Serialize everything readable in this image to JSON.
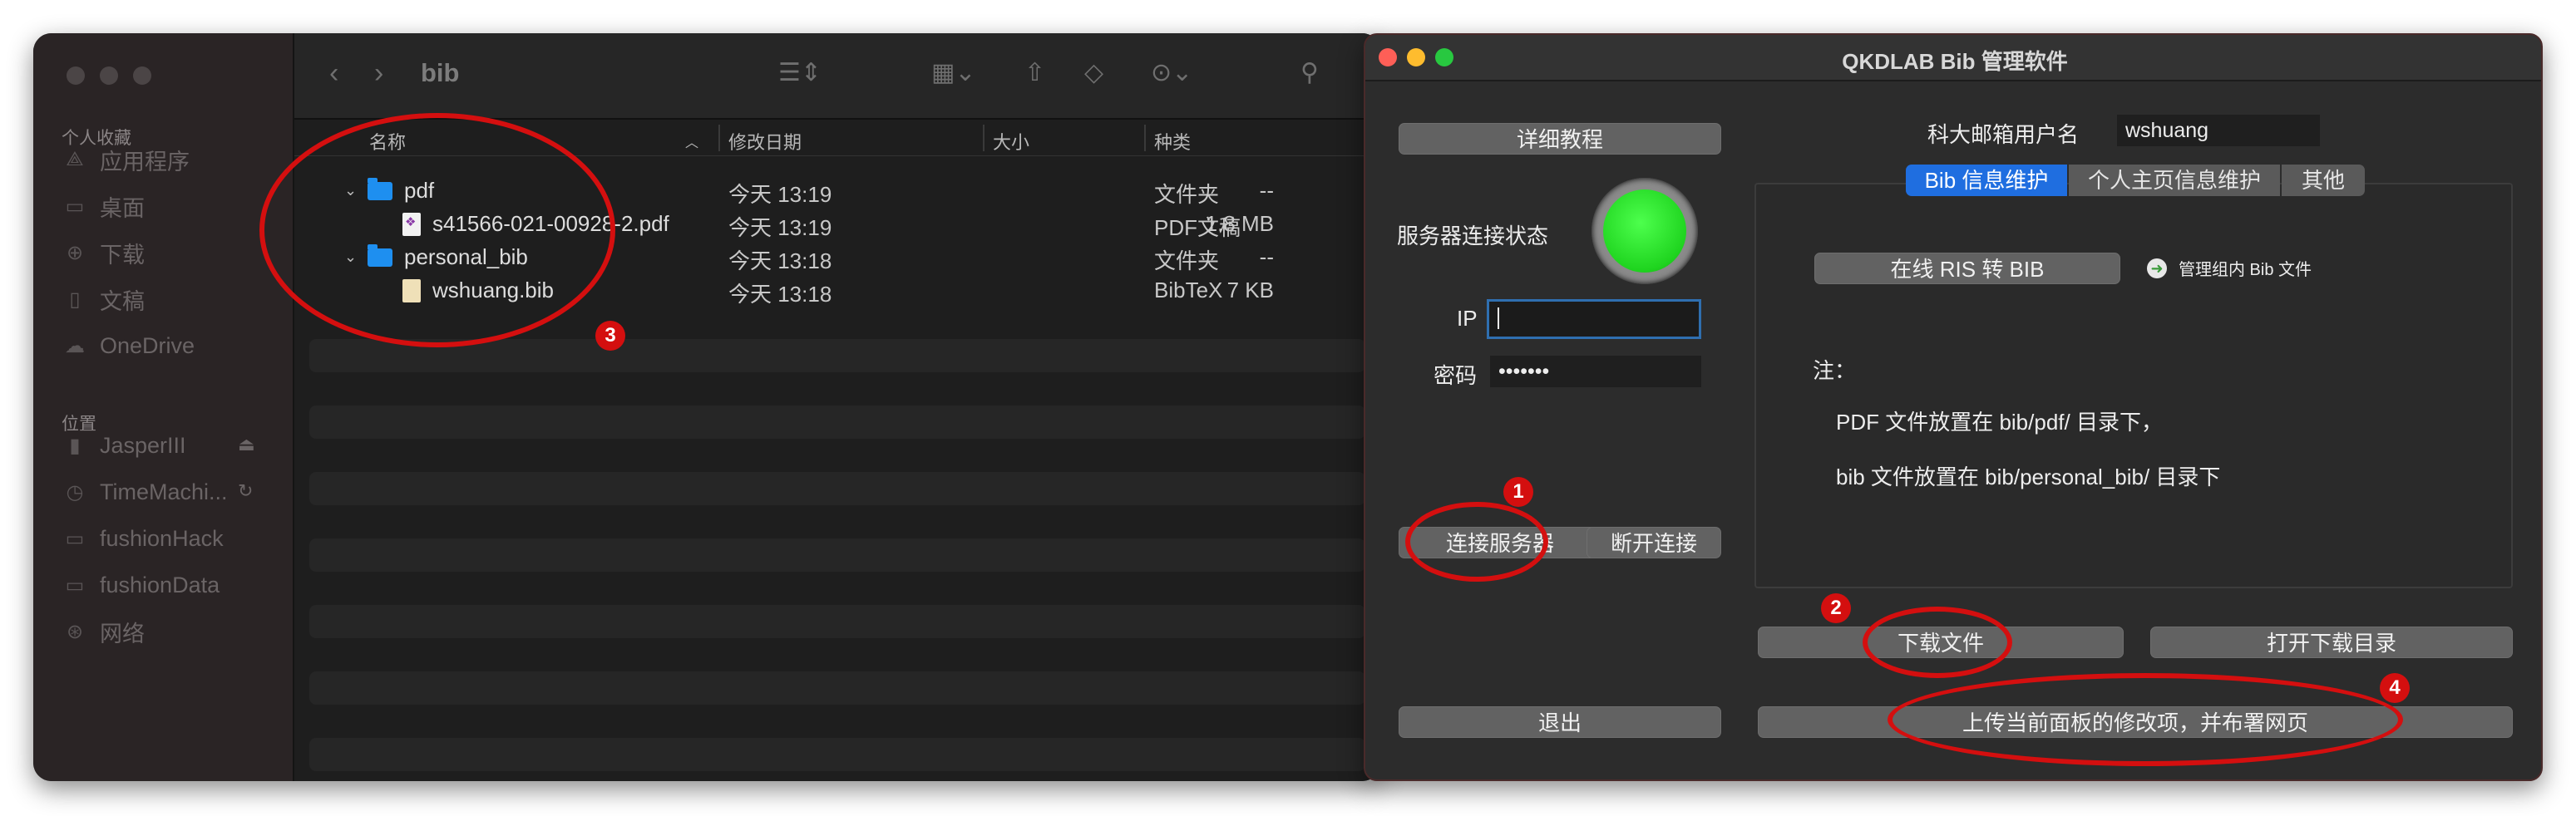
{
  "finder": {
    "title": "bib",
    "sidebar": {
      "favorites_heading": "个人收藏",
      "favorites": [
        {
          "label": "应用程序",
          "icon": "apps-icon"
        },
        {
          "label": "桌面",
          "icon": "desktop-icon"
        },
        {
          "label": "下载",
          "icon": "download-icon"
        },
        {
          "label": "文稿",
          "icon": "document-icon"
        },
        {
          "label": "OneDrive",
          "icon": "cloud-icon"
        }
      ],
      "locations_heading": "位置",
      "locations": [
        {
          "label": "JasperIII",
          "icon": "disk-icon"
        },
        {
          "label": "TimeMachi...",
          "icon": "time-machine-icon"
        },
        {
          "label": "fushionHack",
          "icon": "server-icon"
        },
        {
          "label": "fushionData",
          "icon": "server-icon"
        },
        {
          "label": "网络",
          "icon": "network-icon"
        }
      ]
    },
    "columns": {
      "name": "名称",
      "date": "修改日期",
      "size": "大小",
      "kind": "种类"
    },
    "rows": [
      {
        "name": "pdf",
        "date": "今天 13:19",
        "size": "--",
        "kind": "文件夹"
      },
      {
        "name": "s41566-021-00928-2.pdf",
        "date": "今天 13:19",
        "size": "1.8 MB",
        "kind": "PDF文稿"
      },
      {
        "name": "personal_bib",
        "date": "今天 13:18",
        "size": "--",
        "kind": "文件夹"
      },
      {
        "name": "wshuang.bib",
        "date": "今天 13:18",
        "size": "7 KB",
        "kind": "BibTeX"
      }
    ]
  },
  "app": {
    "title": "QKDLAB Bib 管理软件",
    "tutorial_button": "详细教程",
    "email_label": "科大邮箱用户名",
    "email_value": "wshuang",
    "server_status_label": "服务器连接状态",
    "status_color": "#22dd22",
    "ip_label": "IP",
    "ip_value": "",
    "password_label": "密码",
    "password_value": "•••••••",
    "tabs": [
      "Bib 信息维护",
      "个人主页信息维护",
      "其他"
    ],
    "active_tab": "Bib 信息维护",
    "ris_button": "在线 RIS 转 BIB",
    "manage_link": "管理组内 Bib 文件",
    "note_heading": "注：",
    "note_line1": "PDF 文件放置在 bib/pdf/ 目录下，",
    "note_line2": "bib 文件放置在 bib/personal_bib/ 目录下",
    "connect_button": "连接服务器",
    "disconnect_button": "断开连接",
    "download_button": "下载文件",
    "open_dir_button": "打开下载目录",
    "exit_button": "退出",
    "upload_button": "上传当前面板的修改项，并布署网页"
  },
  "annotations": [
    "1",
    "2",
    "3",
    "4"
  ],
  "colors": {
    "accent": "#1f6ee0",
    "annotation": "#d40f0f",
    "folder": "#1e8ff0"
  }
}
